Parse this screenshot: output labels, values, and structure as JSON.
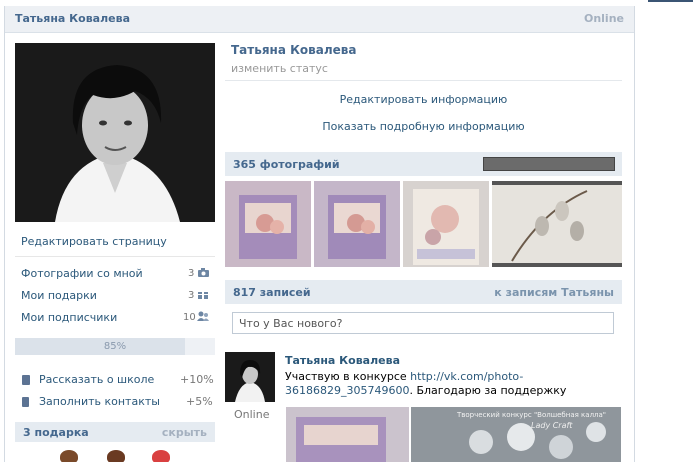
{
  "header": {
    "name": "Татьяна Ковалева",
    "status": "Online"
  },
  "left": {
    "edit_page": "Редактировать страницу",
    "items": [
      {
        "label": "Фотографии со мной",
        "count": "3",
        "icon": "camera-icon"
      },
      {
        "label": "Мои подарки",
        "count": "3",
        "icon": "gift-icon"
      },
      {
        "label": "Мои подписчики",
        "count": "10",
        "icon": "people-icon"
      }
    ],
    "progress": {
      "label": "85%",
      "value": 0.85
    },
    "tasks": [
      {
        "label": "Рассказать о школе",
        "pct": "+10%"
      },
      {
        "label": "Заполнить контакты",
        "pct": "+5%"
      }
    ],
    "gifts": {
      "title": "3 подарка",
      "hide": "скрыть"
    }
  },
  "profile": {
    "name": "Татьяна Ковалева",
    "change_status": "изменить статус",
    "edit_info": "Редактировать информацию",
    "show_info": "Показать подробную информацию"
  },
  "photos": {
    "title": "365 фотографий"
  },
  "wall": {
    "count": "817 записей",
    "to_posts": "к записям Татьяны",
    "input_placeholder": "Что у Вас нового?"
  },
  "post": {
    "author": "Татьяна Ковалева",
    "online": "Online",
    "text_before": "Участвую в конкурсе ",
    "link": "http://vk.com/photo-36186829_305749600",
    "text_after": ". Благодарю за поддержку",
    "image_caption_1": "Творческий конкурс \"Волшебная калла\"",
    "image_caption_2": "Lady Craft"
  },
  "colors": {
    "link": "#2b587a",
    "header_bg": "#edf0f4",
    "section_bg": "#e5ebf1"
  }
}
